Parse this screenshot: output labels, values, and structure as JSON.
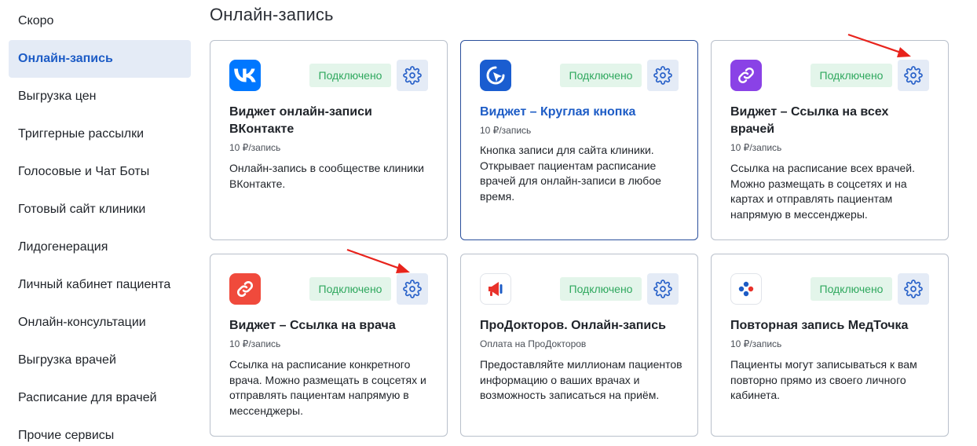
{
  "sidebar": {
    "items": [
      {
        "label": "Скоро"
      },
      {
        "label": "Онлайн-запись"
      },
      {
        "label": "Выгрузка цен"
      },
      {
        "label": "Триггерные рассылки"
      },
      {
        "label": "Голосовые и Чат Боты"
      },
      {
        "label": "Готовый сайт клиники"
      },
      {
        "label": "Лидогенерация"
      },
      {
        "label": "Личный кабинет пациента"
      },
      {
        "label": "Онлайн-консультации"
      },
      {
        "label": "Выгрузка врачей"
      },
      {
        "label": "Расписание для врачей"
      },
      {
        "label": "Прочие сервисы"
      }
    ]
  },
  "page": {
    "title": "Онлайн-запись"
  },
  "cards": [
    {
      "logo": "vk-icon",
      "status": "Подключено",
      "title": "Виджет онлайн-записи ВКонтакте",
      "price": "10 ₽/запись",
      "description": "Онлайн-запись в сообществе клиники ВКонтакте."
    },
    {
      "logo": "round-button-icon",
      "status": "Подключено",
      "title": "Виджет – Круглая кнопка",
      "price": "10 ₽/запись",
      "description": "Кнопка записи для сайта клиники. Открывает пациентам расписание врачей для онлайн-записи в любое время."
    },
    {
      "logo": "chain-link-icon",
      "status": "Подключено",
      "title": "Виджет – Ссылка на всех врачей",
      "price": "10 ₽/запись",
      "description": "Ссылка на расписание всех врачей. Можно размещать в соцсетях и на картах и отправлять пациентам напрямую в мессенджеры."
    },
    {
      "logo": "link-icon",
      "status": "Подключено",
      "title": "Виджет – Ссылка на врача",
      "price": "10 ₽/запись",
      "description": "Ссылка на расписание конкретного врача. Можно размещать в соцсетях и отправлять пациентам напрямую в мессенджеры."
    },
    {
      "logo": "megaphone-icon",
      "status": "Подключено",
      "title": "ПроДокторов. Онлайн-запись",
      "price": "Оплата на ПроДокторов",
      "description": "Предоставляйте миллионам пациентов информацию о ваших врачах и возможность записаться на приём."
    },
    {
      "logo": "medtochka-icon",
      "status": "Подключено",
      "title": "Повторная запись МедТочка",
      "price": "10 ₽/запись",
      "description": "Пациенты могут записываться к вам повторно прямо из своего личного кабинета."
    }
  ],
  "colors": {
    "accent": "#1d5cc6",
    "active_nav_bg": "#e4ebf6",
    "status_bg": "#e3f5ea",
    "status_text": "#2fa85e",
    "annotation_arrow": "#e8231c"
  }
}
